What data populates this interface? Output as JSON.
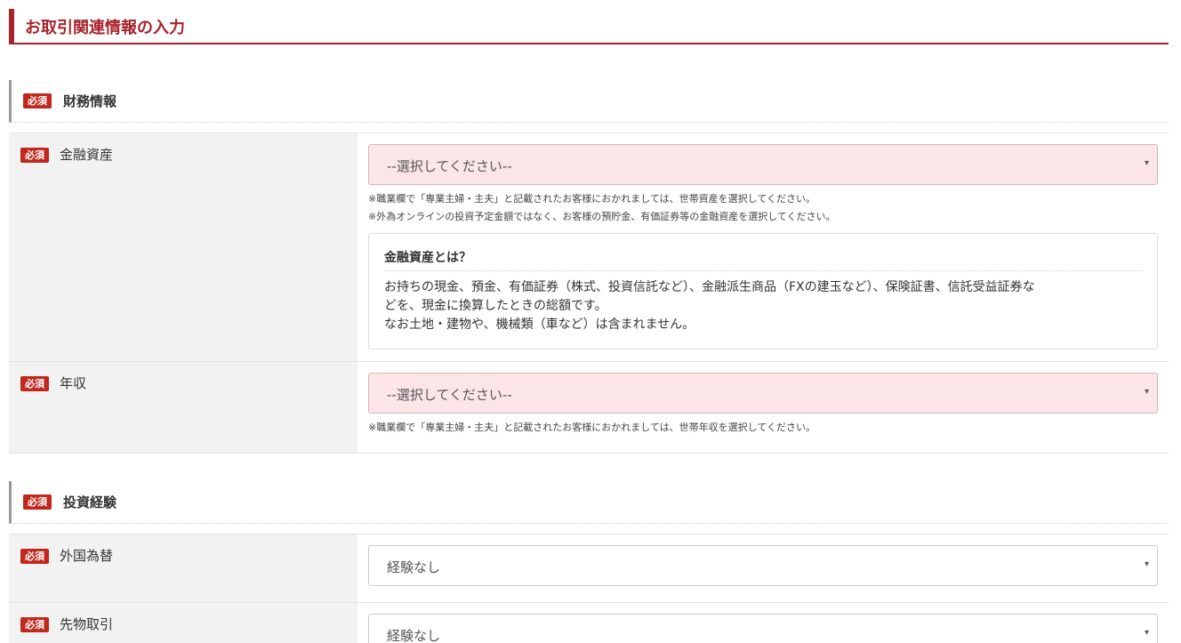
{
  "header": {
    "title": "お取引関連情報の入力"
  },
  "required_badge": "必須",
  "financial": {
    "title": "財務情報",
    "assets": {
      "label": "金融資産",
      "select_value": "--選択してください--",
      "notes": [
        "※職業欄で「専業主婦・主夫」と記載されたお客様におかれましては、世帯資産を選択してください。",
        "※外為オンラインの投資予定金額ではなく、お客様の預貯金、有価証券等の金融資産を選択してください。"
      ],
      "info": {
        "title": "金融資産とは？",
        "lines": [
          "お持ちの現金、預金、有価証券（株式、投資信託など）、金融派生商品（FXの建玉など）、保険証書、信託受益証券な",
          "どを、現金に換算したときの総額です。",
          "なお土地・建物や、機械類（車など）は含まれません。"
        ]
      }
    },
    "income": {
      "label": "年収",
      "select_value": "--選択してください--",
      "notes": [
        "※職業欄で「専業主婦・主夫」と記載されたお客様におかれましては、世帯年収を選択してください。"
      ]
    }
  },
  "experience": {
    "title": "投資経験",
    "forex": {
      "label": "外国為替",
      "select_value": "経験なし"
    },
    "futures": {
      "label": "先物取引",
      "select_value": "経験なし"
    }
  },
  "icons": {
    "caret": "▾"
  },
  "colors": {
    "brand": "#a8232b",
    "badge": "#c0281d",
    "invalid_bg": "#fbe5e7",
    "label_bg": "#f2f2f2"
  }
}
